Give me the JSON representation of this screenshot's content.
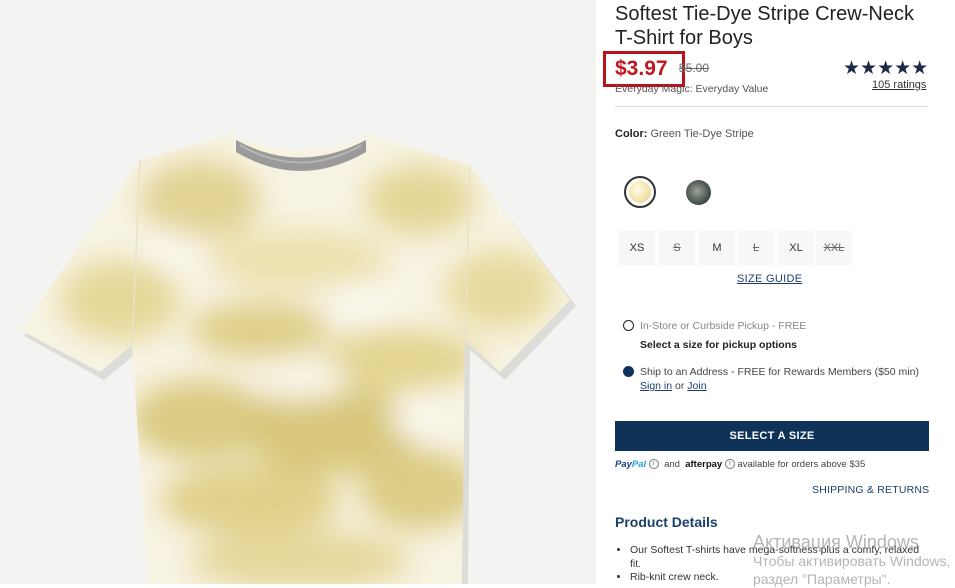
{
  "product": {
    "title": "Softest Tie-Dye Stripe Crew-Neck T-Shirt for Boys",
    "image_icon": "tie-dye-tshirt-photo"
  },
  "price": {
    "current": "$3.97",
    "original": "$5.00",
    "note": "Everyday Magic: Everyday Value",
    "highlight_color": "#b8121d"
  },
  "rating": {
    "stars": "★★★★★",
    "count_label": "105 ratings",
    "value": 5
  },
  "color": {
    "label": "Color:",
    "selected": "Green Tie-Dye Stripe"
  },
  "sizes": [
    {
      "label": "XS",
      "available": true
    },
    {
      "label": "S",
      "available": false
    },
    {
      "label": "M",
      "available": true
    },
    {
      "label": "L",
      "available": false
    },
    {
      "label": "XL",
      "available": true
    },
    {
      "label": "XXL",
      "available": false
    }
  ],
  "size_guide": "SIZE GUIDE",
  "fulfillment": {
    "pickup_label": "In-Store or Curbside Pickup - FREE",
    "pickup_sub": "Select a size for pickup options",
    "ship_label": "Ship to an Address - FREE for Rewards Members ($50 min)",
    "sign_in": "Sign in",
    "or": "or",
    "join": "Join"
  },
  "select_button": "SELECT A SIZE",
  "payments": {
    "paypal_a": "Pay",
    "paypal_b": "Pal",
    "and": "and",
    "afterpay": "afterpay",
    "text": "available for orders above $35"
  },
  "shipping_returns": "SHIPPING & RETURNS",
  "details": {
    "title": "Product Details",
    "bullets": [
      "Our Softest T-shirts have mega-softness plus a comfy, relaxed fit.",
      "Rib-knit crew neck."
    ]
  },
  "watermark": {
    "line1": "Активация Windows",
    "line2": "Чтобы активировать Windows,",
    "line3": "раздел \"Параметры\"."
  },
  "colors": {
    "navy": "#0f3358",
    "price_red": "#c0171f"
  }
}
